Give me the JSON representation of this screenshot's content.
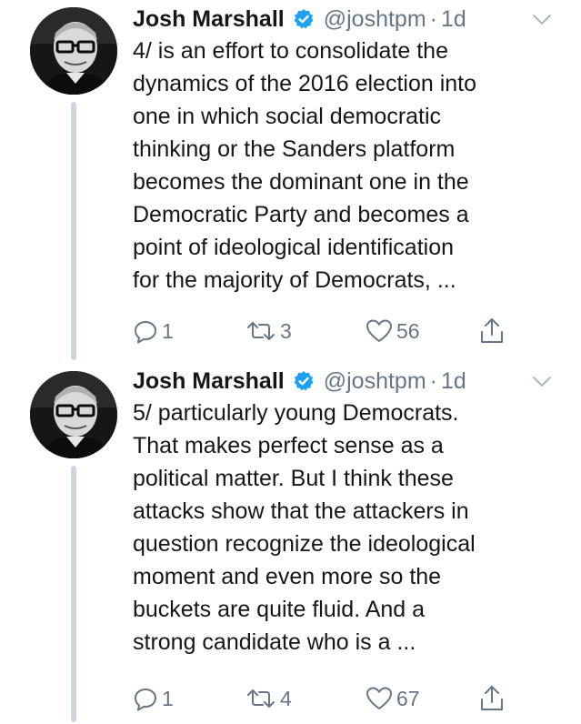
{
  "tweets": [
    {
      "author_name": "Josh Marshall",
      "handle": "@joshtpm",
      "separator": "·",
      "time": "1d",
      "text_lines": [
        "4/ is an effort to consolidate the",
        "dynamics of the 2016 election into",
        "one in which social democratic",
        "thinking or the Sanders platform",
        "becomes the dominant one in the",
        "Democratic Party and becomes a",
        "point of ideological identification",
        "for the majority of Democrats, ..."
      ],
      "replies": "1",
      "retweets": "3",
      "likes": "56"
    },
    {
      "author_name": "Josh Marshall",
      "handle": "@joshtpm",
      "separator": "·",
      "time": "1d",
      "text_lines": [
        "5/ particularly young Democrats.",
        "That makes perfect sense as a",
        "political matter. But I think these",
        "attacks show that the attackers in",
        "question recognize the ideological",
        "moment and even more so the",
        "buckets are quite fluid. And a",
        "strong candidate who is a ..."
      ],
      "replies": "1",
      "retweets": "4",
      "likes": "67"
    }
  ],
  "colors": {
    "text": "#14171a",
    "secondary": "#657786",
    "verified_blue": "#1da1f2",
    "thread_line": "#ccd6dd"
  },
  "icons": {
    "verified": "verified-badge-icon",
    "caret": "chevron-down-icon",
    "reply": "reply-icon",
    "retweet": "retweet-icon",
    "like": "heart-icon",
    "share": "share-icon"
  }
}
